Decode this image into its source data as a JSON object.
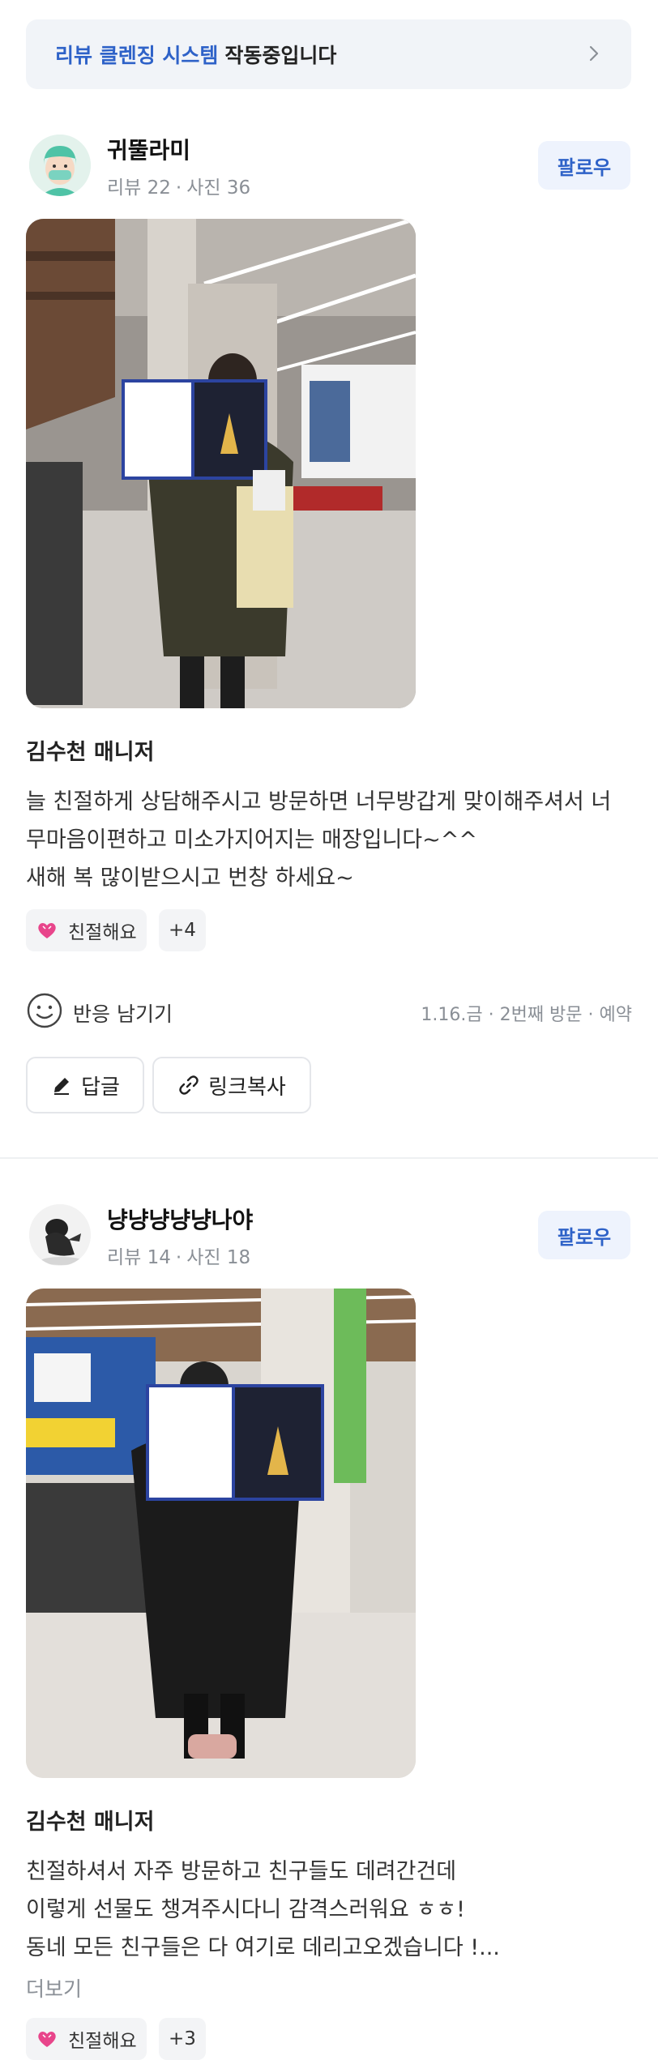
{
  "banner": {
    "accent": "리뷰 클렌징 시스템",
    "text": "작동중입니다"
  },
  "reviews": [
    {
      "nickname": "귀뚤라미",
      "review_count": "리뷰 22",
      "photo_count": "사진 36",
      "follow_label": "팔로우",
      "manager": "김수천 매니저",
      "lines": [
        "늘 친절하게 상담해주시고 방문하면 너무방갑게 맞이해주셔서 너",
        "무마음이편하고 미소가지어지는 매장입니다~^^",
        "새해 복 많이받으시고 번창 하세요~"
      ],
      "tag_label": "친절해요",
      "tag_more": "+4",
      "react_label": "반응 남기기",
      "visit_info": "1.16.금 · 2번째 방문 · 예약",
      "reply_label": "답글",
      "link_label": "링크복사"
    },
    {
      "nickname": "냥냥냥냥냥나야",
      "review_count": "리뷰 14",
      "photo_count": "사진 18",
      "follow_label": "팔로우",
      "manager": "김수천 매니저",
      "lines": [
        "친절하셔서 자주 방문하고 친구들도 데려간건데",
        "이렇게 선물도 챙겨주시다니 감격스러워요 ㅎㅎ!",
        "동네 모든 친구들은 다 여기로 데리고오겠습니다 !..."
      ],
      "more_label": "더보기",
      "tag_label": "친절해요",
      "tag_more": "+3"
    }
  ],
  "colors": {
    "accent": "#2e62c8",
    "follow_bg": "#eef3fd",
    "chip_bg": "#f3f4f6",
    "heart": "#e8458b"
  }
}
